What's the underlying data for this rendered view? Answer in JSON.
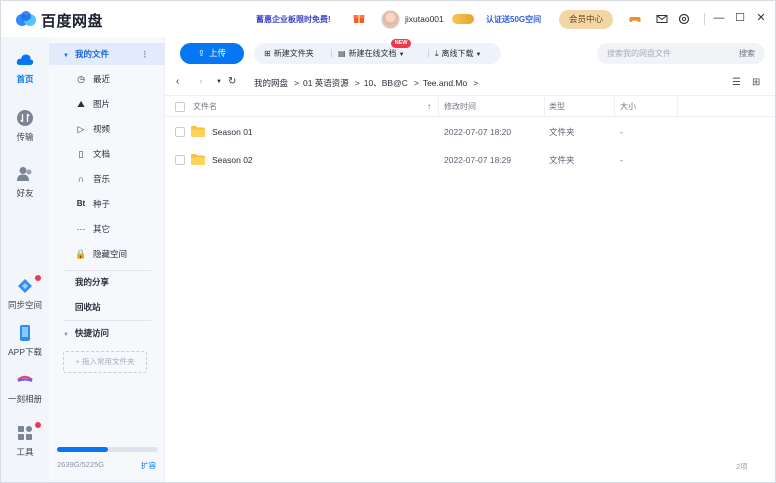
{
  "app": {
    "name": "百度网盘",
    "promo": "蓄惠企业板限时免费!",
    "username": "jixutao001",
    "verify": "认证送50G空间",
    "member_center": "会员中心"
  },
  "rail": {
    "home": "首页",
    "transfer": "传输",
    "friends": "好友",
    "sync": "同步空间",
    "app_download": "APP下载",
    "moments": "一刻相册",
    "tools": "工具"
  },
  "sidebar": {
    "my_files": "我的文件",
    "items": [
      {
        "icon": "clock-icon",
        "glyph": "◷",
        "label": "最近"
      },
      {
        "icon": "image-icon",
        "glyph": "⛰",
        "label": "图片"
      },
      {
        "icon": "video-icon",
        "glyph": "▷",
        "label": "视频"
      },
      {
        "icon": "document-icon",
        "glyph": "▯",
        "label": "文档"
      },
      {
        "icon": "headphones-icon",
        "glyph": "∩",
        "label": "音乐"
      },
      {
        "icon": "bt-icon",
        "glyph": "Bt",
        "label": "种子"
      },
      {
        "icon": "more-icon",
        "glyph": "···",
        "label": "其它"
      },
      {
        "icon": "lock-icon",
        "glyph": "🔒",
        "label": "隐藏空间"
      }
    ],
    "my_share": "我的分享",
    "recycle": "回收站",
    "quick_access": "快捷访问",
    "add_fav": "+ 拖入常用文件夹",
    "storage_text": "2639G/5225G",
    "storage_used_fraction": 0.505,
    "expand": "扩容"
  },
  "toolbar": {
    "upload": "上传",
    "new_folder": "新建文件夹",
    "new_online_doc": "新建在线文档",
    "new_badge": "NEW",
    "offline_download": "离线下载",
    "search_placeholder": "搜索我的网盘文件",
    "search_button": "搜索"
  },
  "breadcrumb": [
    "我的网盘",
    "01 英语资源",
    "10、BB@C",
    "Tee.and.Mo"
  ],
  "table": {
    "headers": {
      "name": "文件名",
      "modified": "修改时间",
      "type": "类型",
      "size": "大小"
    },
    "rows": [
      {
        "name": "Season 01",
        "modified": "2022-07-07 18:20",
        "type": "文件夹",
        "size": "-"
      },
      {
        "name": "Season 02",
        "modified": "2022-07-07 18:29",
        "type": "文件夹",
        "size": "-"
      }
    ],
    "count": "2项"
  },
  "colors": {
    "accent": "#0677f3",
    "folder": "#f5c242",
    "badge": "#f2394b"
  }
}
